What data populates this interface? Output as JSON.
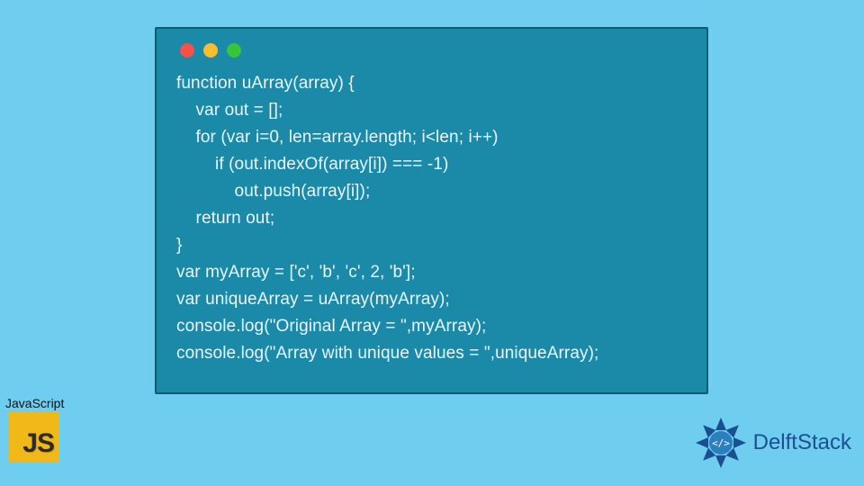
{
  "code_lines": [
    "function uArray(array) {",
    "    var out = [];",
    "    for (var i=0, len=array.length; i<len; i++)",
    "        if (out.indexOf(array[i]) === -1)",
    "            out.push(array[i]);",
    "    return out;",
    "}",
    "var myArray = ['c', 'b', 'c', 2, 'b'];",
    "var uniqueArray = uArray(myArray);",
    "console.log(\"Original Array = \",myArray);",
    "console.log(\"Array with unique values = \",uniqueArray);"
  ],
  "js_badge": {
    "label": "JavaScript",
    "tile_text": "JS"
  },
  "brand": {
    "name": "DelftStack"
  },
  "window_dots": [
    "red",
    "yellow",
    "green"
  ]
}
